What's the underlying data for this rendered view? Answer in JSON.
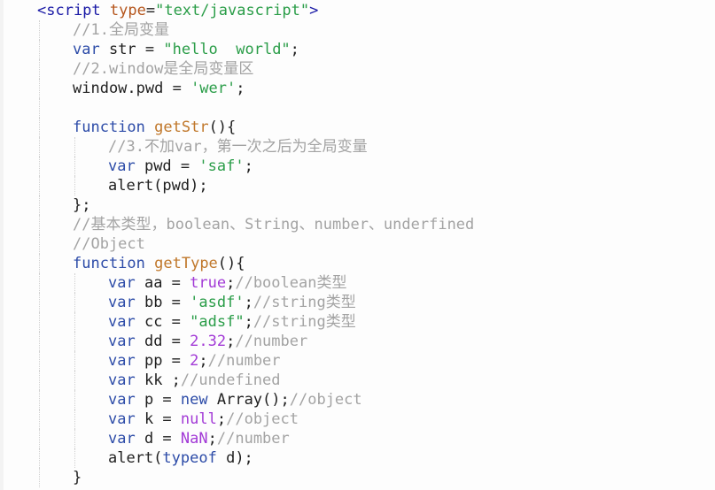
{
  "editor": {
    "language": "javascript",
    "colors": {
      "background": "#fdfdfd",
      "tag": "#1a1aa6",
      "attr": "#b5561d",
      "string": "#2a9d48",
      "keyword": "#2d4ca8",
      "comment": "#a3a3a3",
      "function": "#c0772a",
      "literal": "#a23ad6",
      "text": "#1f1f1f"
    },
    "lines": [
      {
        "indent": 0,
        "tokens": [
          {
            "t": "tag",
            "s": "<script "
          },
          {
            "t": "attr",
            "s": "type"
          },
          {
            "t": "plain",
            "s": "="
          },
          {
            "t": "str",
            "s": "\"text/javascript\""
          },
          {
            "t": "tag",
            "s": ">"
          }
        ]
      },
      {
        "indent": 1,
        "tokens": [
          {
            "t": "com",
            "s": "//1.全局变量"
          }
        ]
      },
      {
        "indent": 1,
        "tokens": [
          {
            "t": "kw",
            "s": "var"
          },
          {
            "t": "plain",
            "s": " str = "
          },
          {
            "t": "str",
            "s": "\"hello  world\""
          },
          {
            "t": "plain",
            "s": ";"
          }
        ]
      },
      {
        "indent": 1,
        "tokens": [
          {
            "t": "com",
            "s": "//2.window是全局变量区"
          }
        ]
      },
      {
        "indent": 1,
        "tokens": [
          {
            "t": "plain",
            "s": "window.pwd = "
          },
          {
            "t": "str",
            "s": "'wer'"
          },
          {
            "t": "plain",
            "s": ";"
          }
        ]
      },
      {
        "indent": 1,
        "tokens": []
      },
      {
        "indent": 1,
        "tokens": [
          {
            "t": "kw",
            "s": "function"
          },
          {
            "t": "plain",
            "s": " "
          },
          {
            "t": "fn",
            "s": "getStr"
          },
          {
            "t": "plain",
            "s": "(){"
          }
        ]
      },
      {
        "indent": 2,
        "tokens": [
          {
            "t": "com",
            "s": "//3.不加var，第一次之后为全局变量"
          }
        ]
      },
      {
        "indent": 2,
        "tokens": [
          {
            "t": "kw",
            "s": "var"
          },
          {
            "t": "plain",
            "s": " pwd = "
          },
          {
            "t": "str",
            "s": "'saf'"
          },
          {
            "t": "plain",
            "s": ";"
          }
        ]
      },
      {
        "indent": 2,
        "tokens": [
          {
            "t": "plain",
            "s": "alert(pwd);"
          }
        ]
      },
      {
        "indent": 1,
        "tokens": [
          {
            "t": "plain",
            "s": "};"
          }
        ]
      },
      {
        "indent": 1,
        "tokens": [
          {
            "t": "com",
            "s": "//基本类型，boolean、String、number、underfined"
          }
        ]
      },
      {
        "indent": 1,
        "tokens": [
          {
            "t": "com",
            "s": "//Object"
          }
        ]
      },
      {
        "indent": 1,
        "tokens": [
          {
            "t": "kw",
            "s": "function"
          },
          {
            "t": "plain",
            "s": " "
          },
          {
            "t": "fn",
            "s": "getType"
          },
          {
            "t": "plain",
            "s": "(){"
          }
        ]
      },
      {
        "indent": 2,
        "tokens": [
          {
            "t": "kw",
            "s": "var"
          },
          {
            "t": "plain",
            "s": " aa = "
          },
          {
            "t": "lit",
            "s": "true"
          },
          {
            "t": "plain",
            "s": ";"
          },
          {
            "t": "com",
            "s": "//boolean类型"
          }
        ]
      },
      {
        "indent": 2,
        "tokens": [
          {
            "t": "kw",
            "s": "var"
          },
          {
            "t": "plain",
            "s": " bb = "
          },
          {
            "t": "str",
            "s": "'asdf'"
          },
          {
            "t": "plain",
            "s": ";"
          },
          {
            "t": "com",
            "s": "//string类型"
          }
        ]
      },
      {
        "indent": 2,
        "tokens": [
          {
            "t": "kw",
            "s": "var"
          },
          {
            "t": "plain",
            "s": " cc = "
          },
          {
            "t": "str",
            "s": "\"adsf\""
          },
          {
            "t": "plain",
            "s": ";"
          },
          {
            "t": "com",
            "s": "//string类型"
          }
        ]
      },
      {
        "indent": 2,
        "tokens": [
          {
            "t": "kw",
            "s": "var"
          },
          {
            "t": "plain",
            "s": " dd = "
          },
          {
            "t": "lit",
            "s": "2.32"
          },
          {
            "t": "plain",
            "s": ";"
          },
          {
            "t": "com",
            "s": "//number"
          }
        ]
      },
      {
        "indent": 2,
        "tokens": [
          {
            "t": "kw",
            "s": "var"
          },
          {
            "t": "plain",
            "s": " pp = "
          },
          {
            "t": "lit",
            "s": "2"
          },
          {
            "t": "plain",
            "s": ";"
          },
          {
            "t": "com",
            "s": "//number"
          }
        ]
      },
      {
        "indent": 2,
        "tokens": [
          {
            "t": "kw",
            "s": "var"
          },
          {
            "t": "plain",
            "s": " kk ;"
          },
          {
            "t": "com",
            "s": "//undefined"
          }
        ]
      },
      {
        "indent": 2,
        "tokens": [
          {
            "t": "kw",
            "s": "var"
          },
          {
            "t": "plain",
            "s": " p = "
          },
          {
            "t": "new",
            "s": "new"
          },
          {
            "t": "plain",
            "s": " Array();"
          },
          {
            "t": "com",
            "s": "//object"
          }
        ]
      },
      {
        "indent": 2,
        "tokens": [
          {
            "t": "kw",
            "s": "var"
          },
          {
            "t": "plain",
            "s": " k = "
          },
          {
            "t": "lit",
            "s": "null"
          },
          {
            "t": "plain",
            "s": ";"
          },
          {
            "t": "com",
            "s": "//object"
          }
        ]
      },
      {
        "indent": 2,
        "tokens": [
          {
            "t": "kw",
            "s": "var"
          },
          {
            "t": "plain",
            "s": " d = "
          },
          {
            "t": "lit",
            "s": "NaN"
          },
          {
            "t": "plain",
            "s": ";"
          },
          {
            "t": "com",
            "s": "//number"
          }
        ]
      },
      {
        "indent": 2,
        "tokens": [
          {
            "t": "plain",
            "s": "alert("
          },
          {
            "t": "kw",
            "s": "typeof"
          },
          {
            "t": "plain",
            "s": " d);"
          }
        ]
      },
      {
        "indent": 1,
        "tokens": [
          {
            "t": "plain",
            "s": "}"
          }
        ]
      }
    ]
  }
}
